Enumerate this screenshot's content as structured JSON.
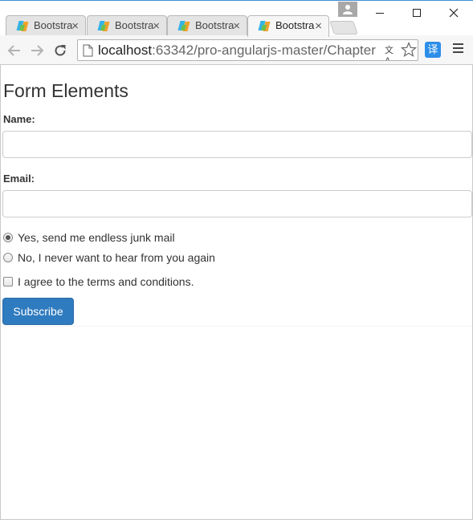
{
  "browser": {
    "tabs": [
      {
        "title": "Bootstra",
        "close": "×"
      },
      {
        "title": "Bootstra",
        "close": "×"
      },
      {
        "title": "Bootstra",
        "close": "×"
      },
      {
        "title": "Bootstra",
        "close": "×",
        "active": true
      }
    ],
    "url_host": "localhost",
    "url_path": ":63342/pro-angularjs-master/Chapter",
    "extension_label": "译",
    "translate_glyph": "文A"
  },
  "page": {
    "heading": "Form Elements",
    "name_label": "Name:",
    "name_value": "",
    "email_label": "Email:",
    "email_value": "",
    "radio_options": [
      {
        "label": "Yes, send me endless junk mail",
        "checked": true
      },
      {
        "label": "No, I never want to hear from you again",
        "checked": false
      }
    ],
    "checkbox_label": "I agree to the terms and conditions.",
    "checkbox_checked": false,
    "submit_label": "Subscribe"
  },
  "colors": {
    "accent": "#2f7bbf",
    "window_border": "#3e8fd6",
    "extension_bg": "#2c8ee8"
  }
}
